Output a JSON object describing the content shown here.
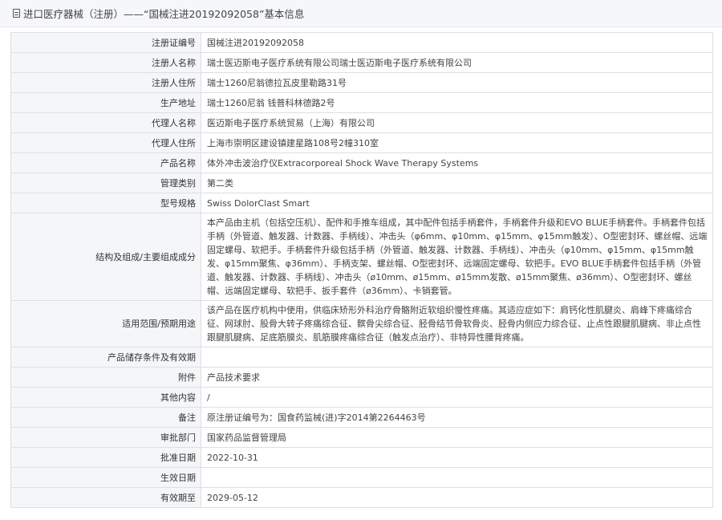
{
  "header": {
    "icon": "document-icon",
    "title": "进口医疗器械（注册）——“国械注进20192092058”基本信息"
  },
  "rows": [
    {
      "label": "注册证编号",
      "value": "国械注进20192092058"
    },
    {
      "label": "注册人名称",
      "value": "瑞士医迈斯电子医疗系统有限公司瑞士医迈斯电子医疗系统有限公司"
    },
    {
      "label": "注册人住所",
      "value": "瑞士1260尼翁德拉瓦皮里勒路31号"
    },
    {
      "label": "生产地址",
      "value": "瑞士1260尼翁 钱普科林德路2号"
    },
    {
      "label": "代理人名称",
      "value": "医迈斯电子医疗系统贸易（上海）有限公司"
    },
    {
      "label": "代理人住所",
      "value": "上海市崇明区建设镇建星路108号2幢310室"
    },
    {
      "label": "产品名称",
      "value": "体外冲击波治疗仪Extracorporeal Shock Wave Therapy Systems"
    },
    {
      "label": "管理类别",
      "value": "第二类"
    },
    {
      "label": "型号规格",
      "value": "Swiss DolorClast Smart"
    },
    {
      "label": "结构及组成/主要组成成分",
      "value": "本产品由主机（包括空压机）、配件和手推车组成，其中配件包括手柄套件，手柄套件升级和EVO BLUE手柄套件。手柄套件包括手柄（外管道、触发器、计数器、手柄线）、冲击头（φ6mm、φ10mm、φ15mm、φ15mm触发）、O型密封环、螺丝帽、远端固定螺母、软把手。手柄套件升级包括手柄（外管道、触发器、计数器、手柄线）、冲击头（φ10mm、φ15mm、φ15mm触发、φ15mm聚焦、φ36mm）、手柄支架、螺丝帽、O型密封环、远端固定螺母、软把手。EVO BLUE手柄套件包括手柄（外管道、触发器、计数器、手柄线）、冲击头（ø10mm、ø15mm、ø15mm发散、ø15mm聚焦、ø36mm）、O型密封环、螺丝帽、远端固定螺母、软把手、扳手套件（ø36mm）、卡销套管。"
    },
    {
      "label": "适用范围/预期用途",
      "value": "该产品在医疗机构中使用，供临床矫形外科治疗骨骼附近软组织慢性疼痛。其适应症如下：肩钙化性肌腱炎、肩峰下疼痛综合征、网球肘、股骨大转子疼痛综合征、髌骨尖综合征、胫骨结节骨软骨炎、胫骨内侧应力综合征、止点性跟腱肌腱病、非止点性跟腱肌腱病、足底筋膜炎、肌筋膜疼痛综合征（触发点治疗）、非特异性腰背疼痛。"
    },
    {
      "label": "产品储存条件及有效期",
      "value": ""
    },
    {
      "label": "附件",
      "value": "产品技术要求"
    },
    {
      "label": "其他内容",
      "value": "/"
    },
    {
      "label": "备注",
      "value": "原注册证编号为：国食药监械(进)字2014第2264463号"
    },
    {
      "label": "审批部门",
      "value": "国家药品监督管理局"
    },
    {
      "label": "批准日期",
      "value": "2022-10-31"
    },
    {
      "label": "生效日期",
      "value": ""
    },
    {
      "label": "有效期至",
      "value": "2029-05-12"
    }
  ]
}
